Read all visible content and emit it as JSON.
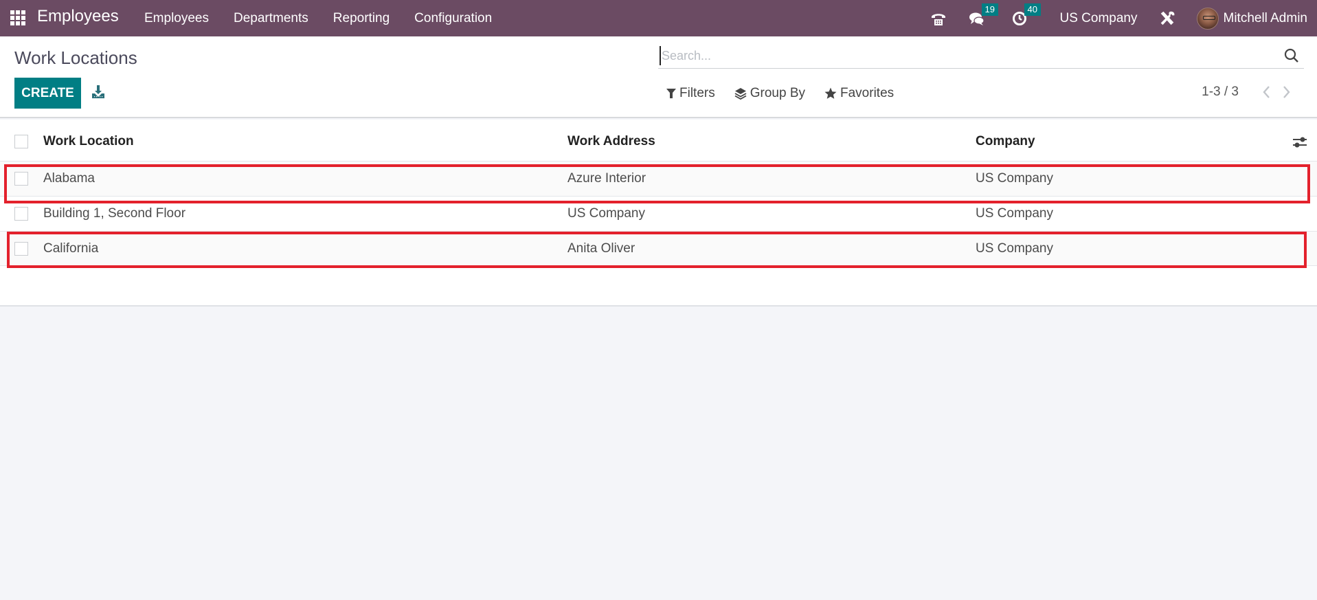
{
  "navbar": {
    "app_name": "Employees",
    "menu": [
      "Employees",
      "Departments",
      "Reporting",
      "Configuration"
    ],
    "messages_badge": "19",
    "activities_badge": "40",
    "company": "US Company",
    "user_name": "Mitchell Admin",
    "icons": [
      "apps-grid-icon",
      "phone-icon",
      "chat-icon",
      "clock-icon",
      "tools-icon"
    ]
  },
  "control_panel": {
    "title": "Work Locations",
    "create_label": "CREATE",
    "search_placeholder": "Search...",
    "search_value": "",
    "filters_label": "Filters",
    "group_by_label": "Group By",
    "favorites_label": "Favorites",
    "pager": "1-3 / 3"
  },
  "table": {
    "columns": [
      "Work Location",
      "Work Address",
      "Company"
    ],
    "rows": [
      {
        "location": "Alabama",
        "address": "Azure Interior",
        "company": "US Company",
        "highlighted": true
      },
      {
        "location": "Building 1, Second Floor",
        "address": "US Company",
        "company": "US Company",
        "highlighted": false
      },
      {
        "location": "California",
        "address": "Anita Oliver",
        "company": "US Company",
        "highlighted": true
      }
    ]
  },
  "colors": {
    "navbar": "#6b4b63",
    "primary": "#017e84",
    "highlight": "#e3212c"
  }
}
